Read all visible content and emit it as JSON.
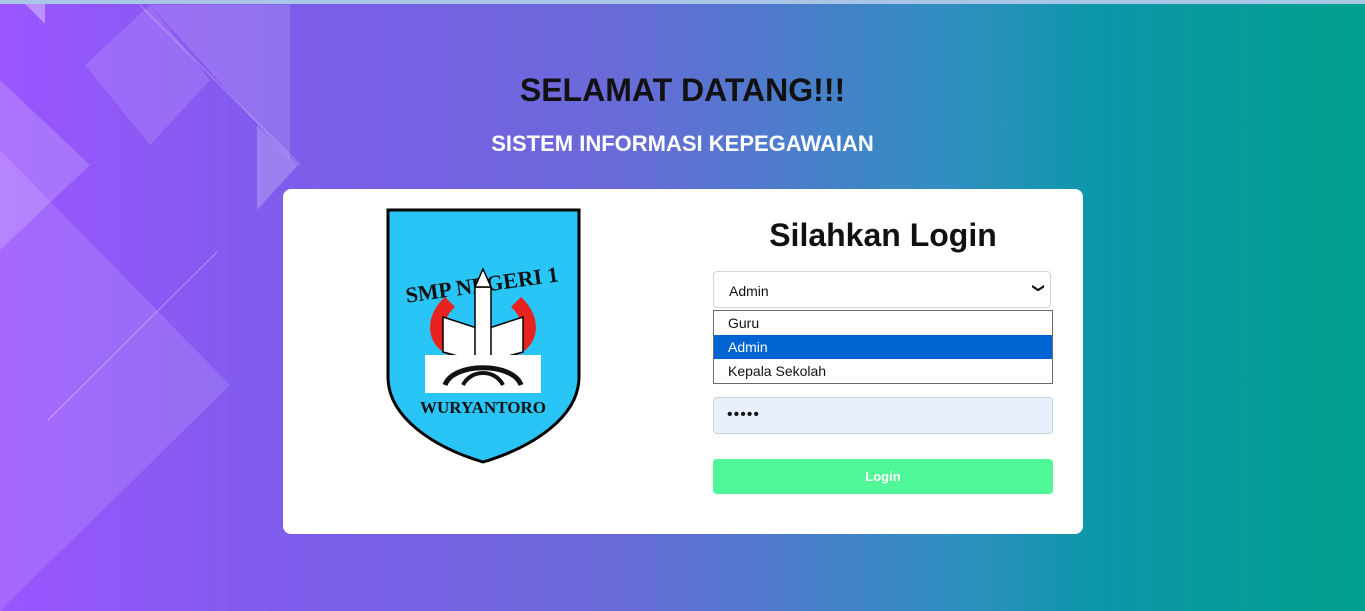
{
  "header": {
    "title": "SELAMAT DATANG!!!",
    "subtitle": "SISTEM INFORMASI KEPEGAWAIAN"
  },
  "logo": {
    "top_text": "SMP NEGERI 1",
    "bottom_text": "WURYANTORO",
    "colors": {
      "shield": "#29c5f6",
      "flame": "#e8231f"
    }
  },
  "login": {
    "title": "Silahkan Login",
    "role_select": {
      "value": "Admin",
      "options": [
        "Guru",
        "Admin",
        "Kepala Sekolah"
      ],
      "selected_index": 1
    },
    "password": {
      "masked_value": "•••••"
    },
    "button_label": "Login"
  },
  "colors": {
    "button": "#50f796",
    "selected_option": "#0064d2",
    "gradient_start": "#9a55ff",
    "gradient_end": "#02a08e"
  }
}
